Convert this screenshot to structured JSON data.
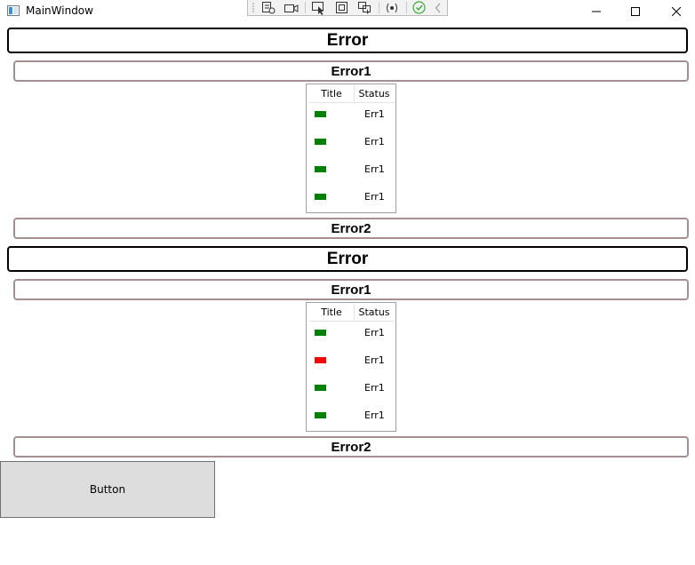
{
  "window": {
    "title": "MainWindow",
    "controls": {
      "minimize_icon": "minimize-icon",
      "maximize_icon": "maximize-icon",
      "close_icon": "close-icon"
    }
  },
  "debug_toolbar": {
    "icons": [
      "grip-icon",
      "visual-tree-icon",
      "record-icon",
      "select-element-icon",
      "display-layout-adorners-icon",
      "track-focused-element-icon",
      "binding-failures-icon",
      "checkmark-icon",
      "chevron-left-icon"
    ],
    "accent": "#3caa3c"
  },
  "sections": [
    {
      "header": "Error",
      "top_label": "Error1",
      "grid": {
        "columns": [
          "Title",
          "Status"
        ],
        "rows": [
          {
            "color": "#008000",
            "status": "Err1"
          },
          {
            "color": "#008000",
            "status": "Err1"
          },
          {
            "color": "#008000",
            "status": "Err1"
          },
          {
            "color": "#008000",
            "status": "Err1"
          }
        ]
      },
      "bottom_label": "Error2"
    },
    {
      "header": "Error",
      "top_label": "Error1",
      "grid": {
        "columns": [
          "Title",
          "Status"
        ],
        "rows": [
          {
            "color": "#008000",
            "status": "Err1"
          },
          {
            "color": "#ff0000",
            "status": "Err1"
          },
          {
            "color": "#008000",
            "status": "Err1"
          },
          {
            "color": "#008000",
            "status": "Err1"
          }
        ]
      },
      "bottom_label": "Error2"
    }
  ],
  "button": {
    "label": "Button"
  }
}
